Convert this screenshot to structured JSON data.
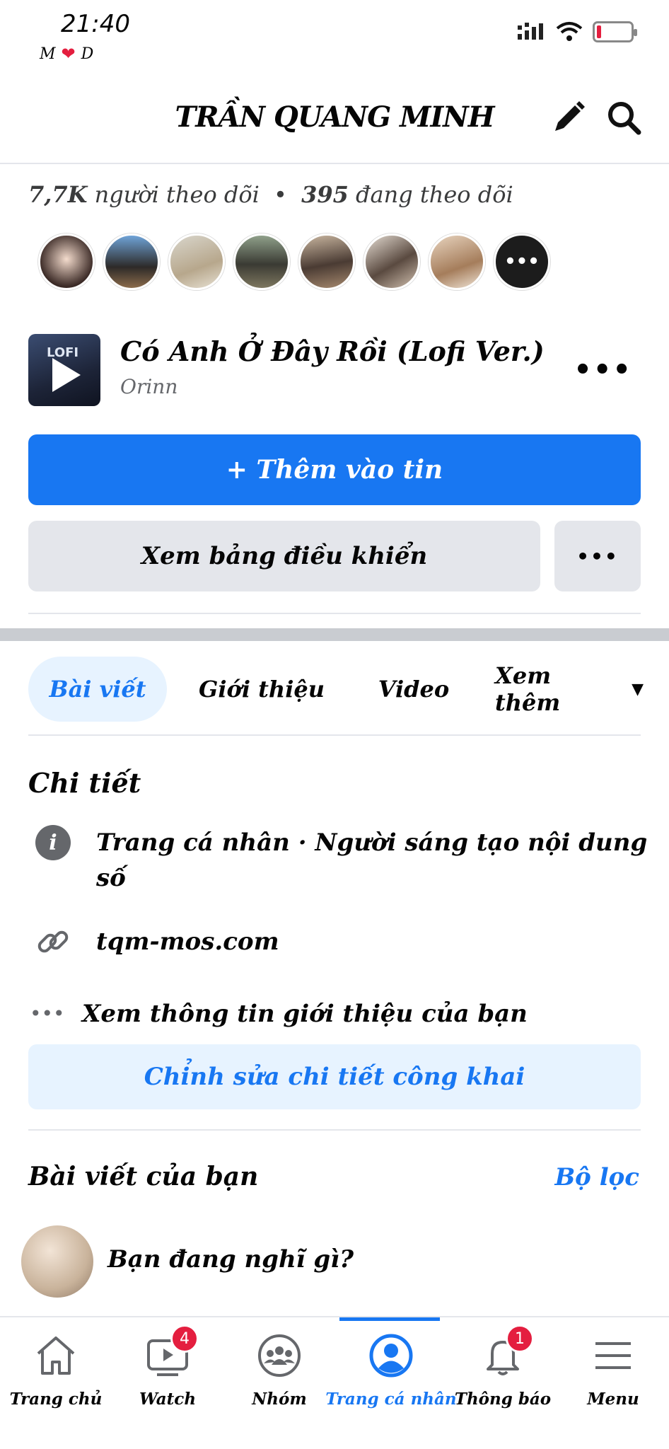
{
  "status_bar": {
    "time": "21:40",
    "sub_left": "M",
    "sub_right": "D"
  },
  "header": {
    "title": "TRẦN QUANG MINH"
  },
  "followers": {
    "count": "7,7K",
    "followers_label": "người theo dõi",
    "separator": "•",
    "following_count": "395",
    "following_label": "đang theo dõi"
  },
  "music": {
    "thumb_tag": "LOFI",
    "title": "Có Anh Ở Đây Rồi (Lofi Ver.)",
    "artist": "Orinn"
  },
  "buttons": {
    "add_story": "+ Thêm vào tin",
    "dashboard": "Xem bảng điều khiển",
    "more": "•••"
  },
  "tabs": {
    "posts": "Bài viết",
    "intro": "Giới thiệu",
    "video": "Video",
    "more": "Xem thêm"
  },
  "details": {
    "title": "Chi tiết",
    "category": "Trang cá nhân · Người sáng tạo nội dung số",
    "website": "tqm-mos.com",
    "see_about": "Xem thông tin giới thiệu của bạn",
    "edit_public": "Chỉnh sửa chi tiết công khai"
  },
  "posts": {
    "title": "Bài viết của bạn",
    "filter": "Bộ lọc",
    "composer_placeholder": "Bạn đang nghĩ gì?"
  },
  "bottom_nav": [
    {
      "label": "Trang chủ",
      "icon": "home-icon",
      "badge": ""
    },
    {
      "label": "Watch",
      "icon": "watch-icon",
      "badge": "4"
    },
    {
      "label": "Nhóm",
      "icon": "groups-icon",
      "badge": ""
    },
    {
      "label": "Trang cá nhân",
      "icon": "profile-icon",
      "badge": ""
    },
    {
      "label": "Thông báo",
      "icon": "bell-icon",
      "badge": "1"
    },
    {
      "label": "Menu",
      "icon": "menu-icon",
      "badge": ""
    }
  ],
  "colors": {
    "accent": "#1877f2",
    "badge": "#e41e3f",
    "light_blue": "#e7f3ff",
    "gray_button": "#e4e6eb"
  }
}
